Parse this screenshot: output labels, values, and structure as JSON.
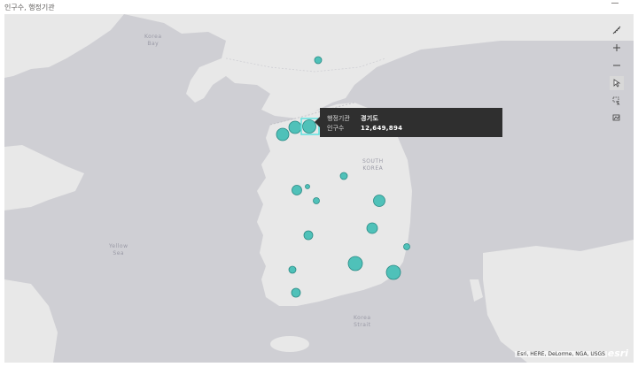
{
  "visual": {
    "title": "인구수, 행정기관"
  },
  "map": {
    "labels": {
      "korea_bay": "Korea\nBay",
      "yellow_sea": "Yellow\nSea",
      "south_korea": "SOUTH\nKOREA",
      "korea_strait": "Korea\nStrait"
    },
    "attribution": "Esri, HERE, DeLorme, NGA, USGS",
    "logo": "esri",
    "colors": {
      "water": "#cfcfd4",
      "land": "#e8e8e8",
      "bubble_fill": "#4fc1b9",
      "bubble_stroke": "#2a8a84",
      "highlight": "#5ee3e0"
    }
  },
  "tooltip": {
    "field1_label": "행정기관",
    "field1_value": "경기도",
    "field2_label": "인구수",
    "field2_value": "12,649,894"
  },
  "toolbar": {
    "icons": [
      "ruler-icon",
      "zoom-in-icon",
      "zoom-out-icon",
      "pointer-icon",
      "select-rect-icon",
      "lasso-icon"
    ]
  }
}
